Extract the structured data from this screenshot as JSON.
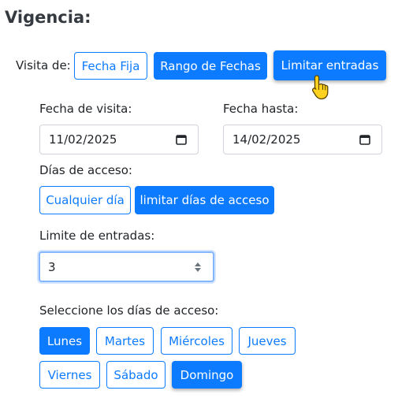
{
  "heading": "Vigencia:",
  "visit_type": {
    "label": "Visita de:",
    "options": [
      "Fecha Fija",
      "Rango de Fechas",
      "Limitar entradas"
    ]
  },
  "date_from": {
    "label": "Fecha de visita:",
    "value": "11/02/2025",
    "icon": "calendar-icon"
  },
  "date_to": {
    "label": "Fecha hasta:",
    "value": "14/02/2025",
    "icon": "calendar-icon"
  },
  "access_days": {
    "label": "Días de acceso:",
    "options": [
      "Cualquier día",
      "limitar días de acceso"
    ]
  },
  "entries_limit": {
    "label": "Limite de entradas:",
    "value": "3",
    "icon": "spinner-arrows-icon"
  },
  "day_select": {
    "label": "Seleccione los días de acceso:",
    "days": [
      "Lunes",
      "Martes",
      "Miércoles",
      "Jueves",
      "Viernes",
      "Sábado",
      "Domingo"
    ],
    "selected": [
      "Lunes",
      "Domingo"
    ]
  },
  "colors": {
    "primary": "#0d7bff",
    "cursor": "#ffd21f"
  }
}
